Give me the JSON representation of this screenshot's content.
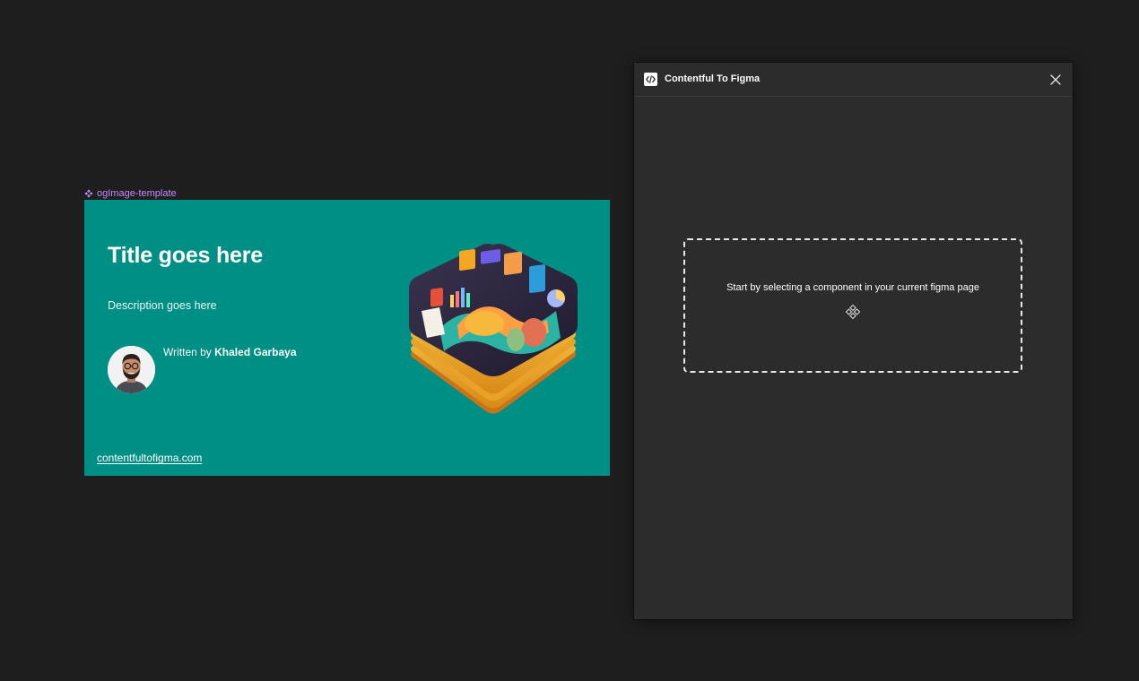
{
  "frame": {
    "label": "ogImage-template",
    "label_icon": "component-icon"
  },
  "og": {
    "title": "Title goes here",
    "description": "Description goes here",
    "written_prefix": "Written by ",
    "author": "Khaled Garbaya",
    "url": "contentfultofigma.com",
    "background_color": "#008f84"
  },
  "plugin": {
    "title": "Contentful To Figma",
    "icon": "code-icon",
    "close_icon": "close-icon",
    "dropzone_message": "Start by selecting a component in your current figma page",
    "dropzone_icon": "component-icon"
  },
  "colors": {
    "canvas": "#1e1e1e",
    "panel": "#2c2c2c",
    "frame_label": "#c58cff"
  }
}
